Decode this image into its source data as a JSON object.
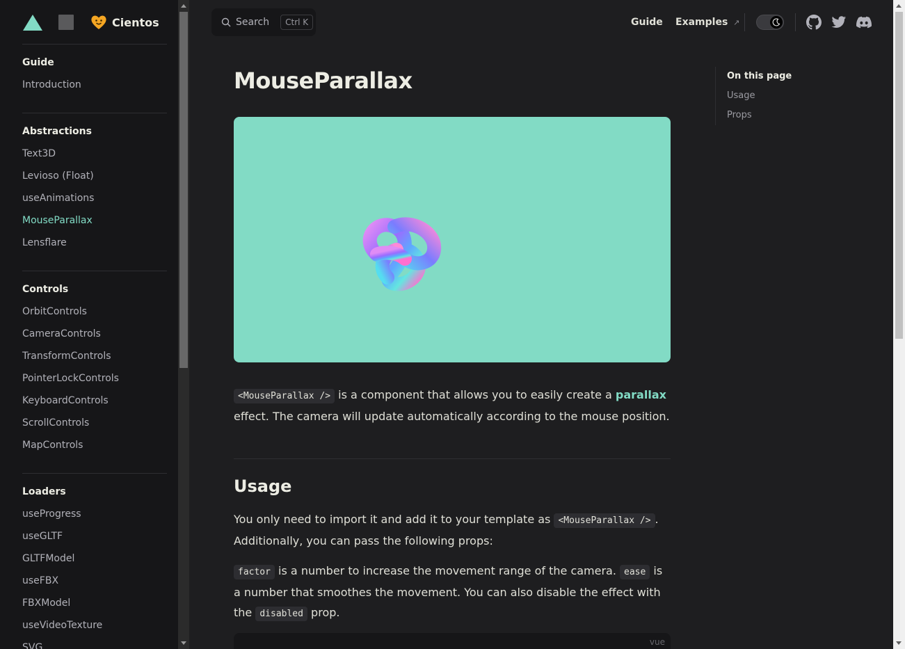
{
  "brand": {
    "name": "Cientos"
  },
  "sidebar": {
    "sections": [
      {
        "title": "Guide",
        "items": [
          {
            "label": "Introduction"
          }
        ]
      },
      {
        "title": "Abstractions",
        "items": [
          {
            "label": "Text3D"
          },
          {
            "label": "Levioso (Float)"
          },
          {
            "label": "useAnimations"
          },
          {
            "label": "MouseParallax",
            "active": true
          },
          {
            "label": "Lensflare"
          }
        ]
      },
      {
        "title": "Controls",
        "items": [
          {
            "label": "OrbitControls"
          },
          {
            "label": "CameraControls"
          },
          {
            "label": "TransformControls"
          },
          {
            "label": "PointerLockControls"
          },
          {
            "label": "KeyboardControls"
          },
          {
            "label": "ScrollControls"
          },
          {
            "label": "MapControls"
          }
        ]
      },
      {
        "title": "Loaders",
        "items": [
          {
            "label": "useProgress"
          },
          {
            "label": "useGLTF"
          },
          {
            "label": "GLTFModel"
          },
          {
            "label": "useFBX"
          },
          {
            "label": "FBXModel"
          },
          {
            "label": "useVideoTexture"
          },
          {
            "label": "SVG"
          }
        ]
      }
    ]
  },
  "search": {
    "label": "Search",
    "shortcut": "Ctrl K"
  },
  "nav": {
    "guide": "Guide",
    "examples": "Examples",
    "examples_icon": "↗"
  },
  "page": {
    "title": "MouseParallax",
    "intro": {
      "code": "<MouseParallax />",
      "text1": " is a component that allows you to easily create a ",
      "link": "parallax",
      "text2": " effect. The camera will update automatically according to the mouse position."
    },
    "usage_heading": "Usage",
    "usage_p1": {
      "text1": "You only need to import it and add it to your template as ",
      "code": "<MouseParallax />",
      "text2": ". Additionally, you can pass the following props:"
    },
    "usage_p2": {
      "code1": "factor",
      "text1": " is a number to increase the movement range of the camera. ",
      "code2": "ease",
      "text2": " is a number that smoothes the movement. You can also disable the effect with the ",
      "code3": "disabled",
      "text3": " prop."
    },
    "codeblock_lang": "vue"
  },
  "outline": {
    "title": "On this page",
    "items": [
      {
        "label": "Usage"
      },
      {
        "label": "Props"
      }
    ]
  },
  "colors": {
    "accent": "#82dbc5",
    "background": "#1e1e20",
    "sidebar": "#161618",
    "heart": "#f5a623"
  }
}
